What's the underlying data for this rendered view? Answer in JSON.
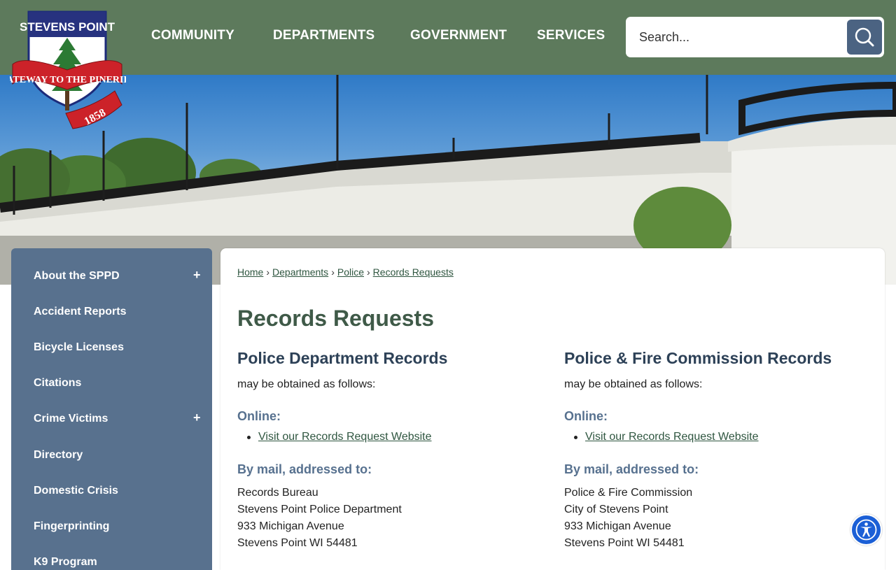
{
  "logo": {
    "top_text": "STEVENS POINT",
    "banner_text": "GATEWAY TO THE PINERIES",
    "year": "1858"
  },
  "nav": {
    "items": [
      "COMMUNITY",
      "DEPARTMENTS",
      "GOVERNMENT",
      "SERVICES"
    ]
  },
  "search": {
    "placeholder": "Search..."
  },
  "sidebar": {
    "items": [
      {
        "label": "About the SPPD",
        "expandable": "+"
      },
      {
        "label": "Accident Reports"
      },
      {
        "label": "Bicycle Licenses"
      },
      {
        "label": "Citations"
      },
      {
        "label": "Crime Victims",
        "expandable": "+"
      },
      {
        "label": "Directory"
      },
      {
        "label": "Domestic Crisis"
      },
      {
        "label": "Fingerprinting"
      },
      {
        "label": "K9 Program"
      }
    ]
  },
  "breadcrumb": [
    "Home",
    "Departments",
    "Police",
    "Records Requests"
  ],
  "page_title": "Records Requests",
  "columns": [
    {
      "heading": "Police Department Records",
      "subtitle": "may be obtained as follows:",
      "online_label": "Online:",
      "link_text": "Visit our Records Request Website",
      "mail_label": "By mail, addressed to:",
      "address": [
        "Records Bureau",
        "Stevens Point Police Department",
        "933 Michigan Avenue",
        "Stevens Point WI 54481"
      ]
    },
    {
      "heading": "Police & Fire Commission Records",
      "subtitle": "may be obtained as follows:",
      "online_label": "Online:",
      "link_text": "Visit our Records Request Website",
      "mail_label": "By mail, addressed to:",
      "address": [
        "Police & Fire Commission",
        "City of Stevens Point",
        "933 Michigan Avenue",
        "Stevens Point WI 54481"
      ]
    }
  ],
  "colors": {
    "header_bg": "#5d7a5c",
    "sidebar_bg": "#58718e",
    "title_green": "#3f5a48",
    "link_green": "#2f5640",
    "accessibility_blue": "#1b5fd6"
  }
}
